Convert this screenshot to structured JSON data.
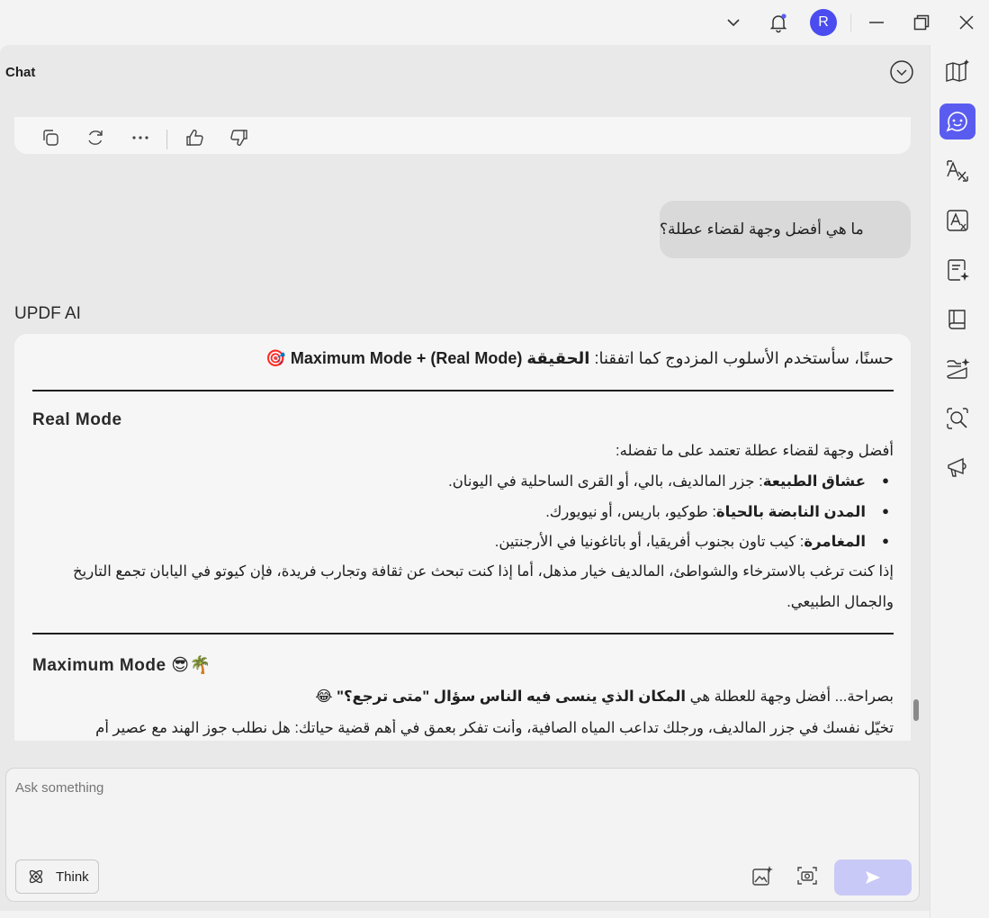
{
  "window": {
    "avatar_initial": "R"
  },
  "chat": {
    "title": "Chat",
    "ai_label": "UPDF AI",
    "user_message": "ما هي أفضل وجهة لقضاء عطلة؟",
    "response": {
      "intro_prefix": "حسنًا، سأستخدم الأسلوب المزدوج كما اتفقنا: ",
      "intro_bold": "الحقيقة (Real Mode)",
      "intro_suffix": " + Maximum Mode 🎯",
      "real_mode_heading": "Real Mode",
      "real_mode_lead": "أفضل وجهة لقضاء عطلة تعتمد على ما تفضله:",
      "bullets": [
        {
          "bold": "عشاق الطبيعة",
          "text": ": جزر المالديف، بالي، أو القرى الساحلية في اليونان."
        },
        {
          "bold": "المدن النابضة بالحياة",
          "text": ": طوكيو، باريس، أو نيويورك."
        },
        {
          "bold": "المغامرة",
          "text": ": كيب تاون بجنوب أفريقيا، أو باتاغونيا في الأرجنتين."
        }
      ],
      "real_mode_paragraph": "إذا كنت ترغب بالاسترخاء والشواطئ، المالديف خيار مذهل، أما إذا كنت تبحث عن ثقافة وتجارب فريدة، فإن كيوتو في اليابان تجمع التاريخ والجمال الطبيعي.",
      "max_mode_heading": "Maximum Mode 😎🌴",
      "max_mode_line1_prefix": "بصراحة... أفضل وجهة للعطلة هي ",
      "max_mode_line1_bold": "المكان الذي ينسى فيه الناس سؤال \"متى ترجع؟\"",
      "max_mode_line1_suffix": " 😂",
      "max_mode_line2": "تخيّل نفسك في جزر المالديف، ورجلك تداعب المياه الصافية، وأنت تفكر بعمق في أهم قضية حياتك: هل نطلب جوز الهند مع عصير أم"
    }
  },
  "input": {
    "placeholder": "Ask something",
    "think_label": "Think"
  },
  "colors": {
    "accent": "#5a5cf0",
    "send_disabled": "#c8c9f6"
  }
}
